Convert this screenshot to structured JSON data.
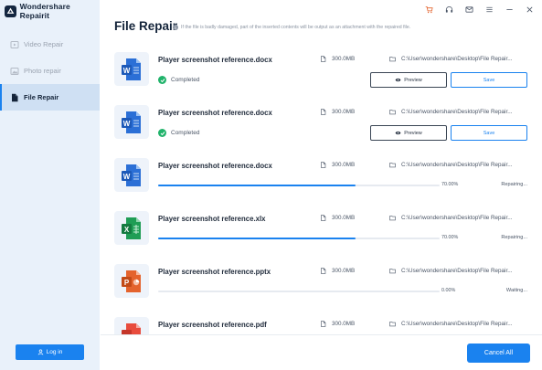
{
  "app": {
    "title": "Wondershare Repairit"
  },
  "sidebar": {
    "items": [
      {
        "label": "Video Repair",
        "icon": "video-icon"
      },
      {
        "label": "Photo repair",
        "icon": "photo-icon"
      },
      {
        "label": "File Repair",
        "icon": "file-icon",
        "active": true
      }
    ],
    "login_label": "Log in"
  },
  "titlebar": {
    "icons": [
      "cart-icon",
      "headset-icon",
      "mail-icon",
      "menu-icon",
      "minimize-icon",
      "close-icon"
    ]
  },
  "header": {
    "title": "File Repair",
    "hint": "If the file is badly damaged, part of the inserted contents will be output as an attachment with the repaired file."
  },
  "files": [
    {
      "name": "Player screenshot reference.docx",
      "type": "word",
      "size": "300.0MB",
      "path": "C:\\User\\wondershare\\Desktop\\File Repair...",
      "status": "completed",
      "status_text": "Completed",
      "preview_label": "Preview",
      "save_label": "Save"
    },
    {
      "name": "Player screenshot reference.docx",
      "type": "word",
      "size": "300.0MB",
      "path": "C:\\User\\wondershare\\Desktop\\File Repair...",
      "status": "completed",
      "status_text": "Completed",
      "preview_label": "Preview",
      "save_label": "Save"
    },
    {
      "name": "Player screenshot reference.docx",
      "type": "word",
      "size": "300.0MB",
      "path": "C:\\User\\wondershare\\Desktop\\File Repair...",
      "status": "progress",
      "progress": 70,
      "progress_text": "70.00%",
      "state_text": "Repairing..."
    },
    {
      "name": "Player screenshot reference.xlx",
      "type": "excel",
      "size": "300.0MB",
      "path": "C:\\User\\wondershare\\Desktop\\File Repair...",
      "status": "progress",
      "progress": 70,
      "progress_text": "70.00%",
      "state_text": "Repairing..."
    },
    {
      "name": "Player screenshot reference.pptx",
      "type": "powerpoint",
      "size": "300.0MB",
      "path": "C:\\User\\wondershare\\Desktop\\File Repair...",
      "status": "progress",
      "progress": 0,
      "progress_text": "0.00%",
      "state_text": "Waiting..."
    },
    {
      "name": "Player screenshot reference.pdf",
      "type": "pdf",
      "size": "300.0MB",
      "path": "C:\\User\\wondershare\\Desktop\\File Repair...",
      "status": "none"
    }
  ],
  "footer": {
    "cancel_all_label": "Cancel All"
  },
  "colors": {
    "accent": "#1a82ef",
    "success": "#21b36b",
    "word": "#2b6fd6",
    "excel": "#1f9d55",
    "powerpoint": "#e4632d",
    "pdf": "#e84c3d"
  }
}
